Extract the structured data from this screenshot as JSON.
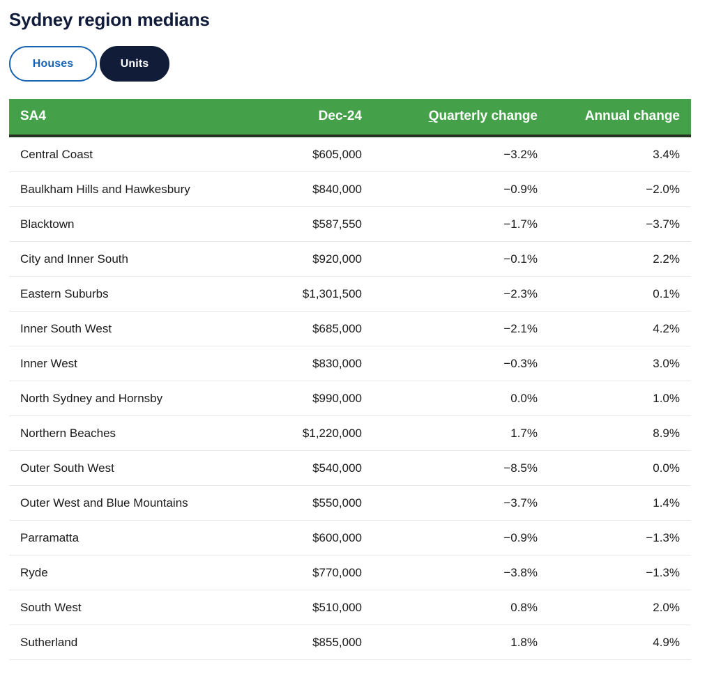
{
  "page_title": "Sydney region medians",
  "toggle": {
    "options": [
      {
        "label": "Houses",
        "state": "inactive"
      },
      {
        "label": "Units",
        "state": "active"
      }
    ],
    "selected": "Units"
  },
  "colors": {
    "title": "#101c3a",
    "header_green": "#45a04a",
    "header_underline": "#24331f",
    "pill_active_bg": "#101c38",
    "pill_inactive_border": "#1763b4",
    "pill_inactive_text": "#1763b4",
    "row_divider": "#e8e8e8",
    "body_text": "#1a1a1a"
  },
  "table": {
    "columns": [
      {
        "key": "sa4",
        "label": "SA4",
        "align": "left",
        "accesskey": ""
      },
      {
        "key": "median",
        "label": "Dec-24",
        "align": "right",
        "accesskey": ""
      },
      {
        "key": "qchange",
        "label": "Quarterly change",
        "align": "right",
        "accesskey": "Q"
      },
      {
        "key": "achange",
        "label": "Annual change",
        "align": "right",
        "accesskey": ""
      }
    ],
    "rows": [
      {
        "sa4": "Central Coast",
        "median": "$605,000",
        "qchange": "−3.2%",
        "achange": "3.4%"
      },
      {
        "sa4": "Baulkham Hills and Hawkesbury",
        "median": "$840,000",
        "qchange": "−0.9%",
        "achange": "−2.0%"
      },
      {
        "sa4": "Blacktown",
        "median": "$587,550",
        "qchange": "−1.7%",
        "achange": "−3.7%"
      },
      {
        "sa4": "City and Inner South",
        "median": "$920,000",
        "qchange": "−0.1%",
        "achange": "2.2%"
      },
      {
        "sa4": "Eastern Suburbs",
        "median": "$1,301,500",
        "qchange": "−2.3%",
        "achange": "0.1%"
      },
      {
        "sa4": "Inner South West",
        "median": "$685,000",
        "qchange": "−2.1%",
        "achange": "4.2%"
      },
      {
        "sa4": "Inner West",
        "median": "$830,000",
        "qchange": "−0.3%",
        "achange": "3.0%"
      },
      {
        "sa4": "North Sydney and Hornsby",
        "median": "$990,000",
        "qchange": "0.0%",
        "achange": "1.0%"
      },
      {
        "sa4": "Northern Beaches",
        "median": "$1,220,000",
        "qchange": "1.7%",
        "achange": "8.9%"
      },
      {
        "sa4": "Outer South West",
        "median": "$540,000",
        "qchange": "−8.5%",
        "achange": "0.0%"
      },
      {
        "sa4": "Outer West and Blue Mountains",
        "median": "$550,000",
        "qchange": "−3.7%",
        "achange": "1.4%"
      },
      {
        "sa4": "Parramatta",
        "median": "$600,000",
        "qchange": "−0.9%",
        "achange": "−1.3%"
      },
      {
        "sa4": "Ryde",
        "median": "$770,000",
        "qchange": "−3.8%",
        "achange": "−1.3%"
      },
      {
        "sa4": "South West",
        "median": "$510,000",
        "qchange": "0.8%",
        "achange": "2.0%"
      },
      {
        "sa4": "Sutherland",
        "median": "$855,000",
        "qchange": "1.8%",
        "achange": "4.9%"
      }
    ]
  }
}
